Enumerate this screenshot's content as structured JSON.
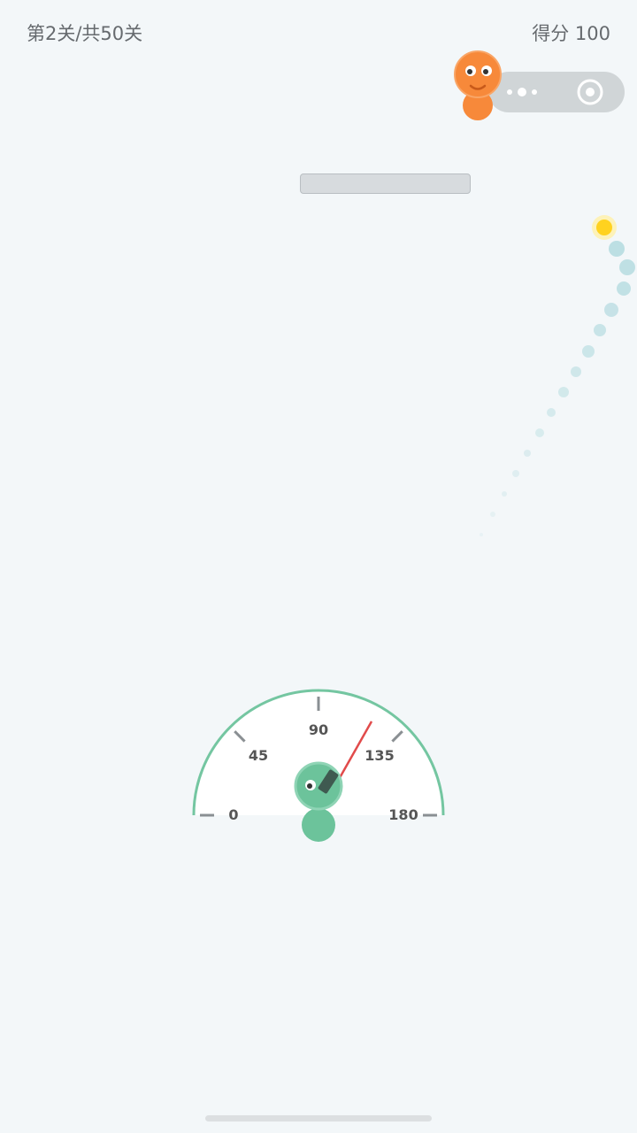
{
  "hud": {
    "level_text": "第2关/共50关",
    "score_text": "得分 100"
  },
  "menu_capsule": {
    "more_icon": "ellipsis-icon",
    "close_icon": "target-circle-icon"
  },
  "protractor": {
    "labels": [
      "0",
      "45",
      "90",
      "135",
      "180"
    ],
    "aim_angle_degrees": 123,
    "arc_color": "#74c6a1",
    "needle_color": "#e14b4b"
  },
  "colors": {
    "player": "#6cc39b",
    "opponent": "#f7893a",
    "sun": "#ffd21f",
    "trajectory": "#b8dde1"
  }
}
